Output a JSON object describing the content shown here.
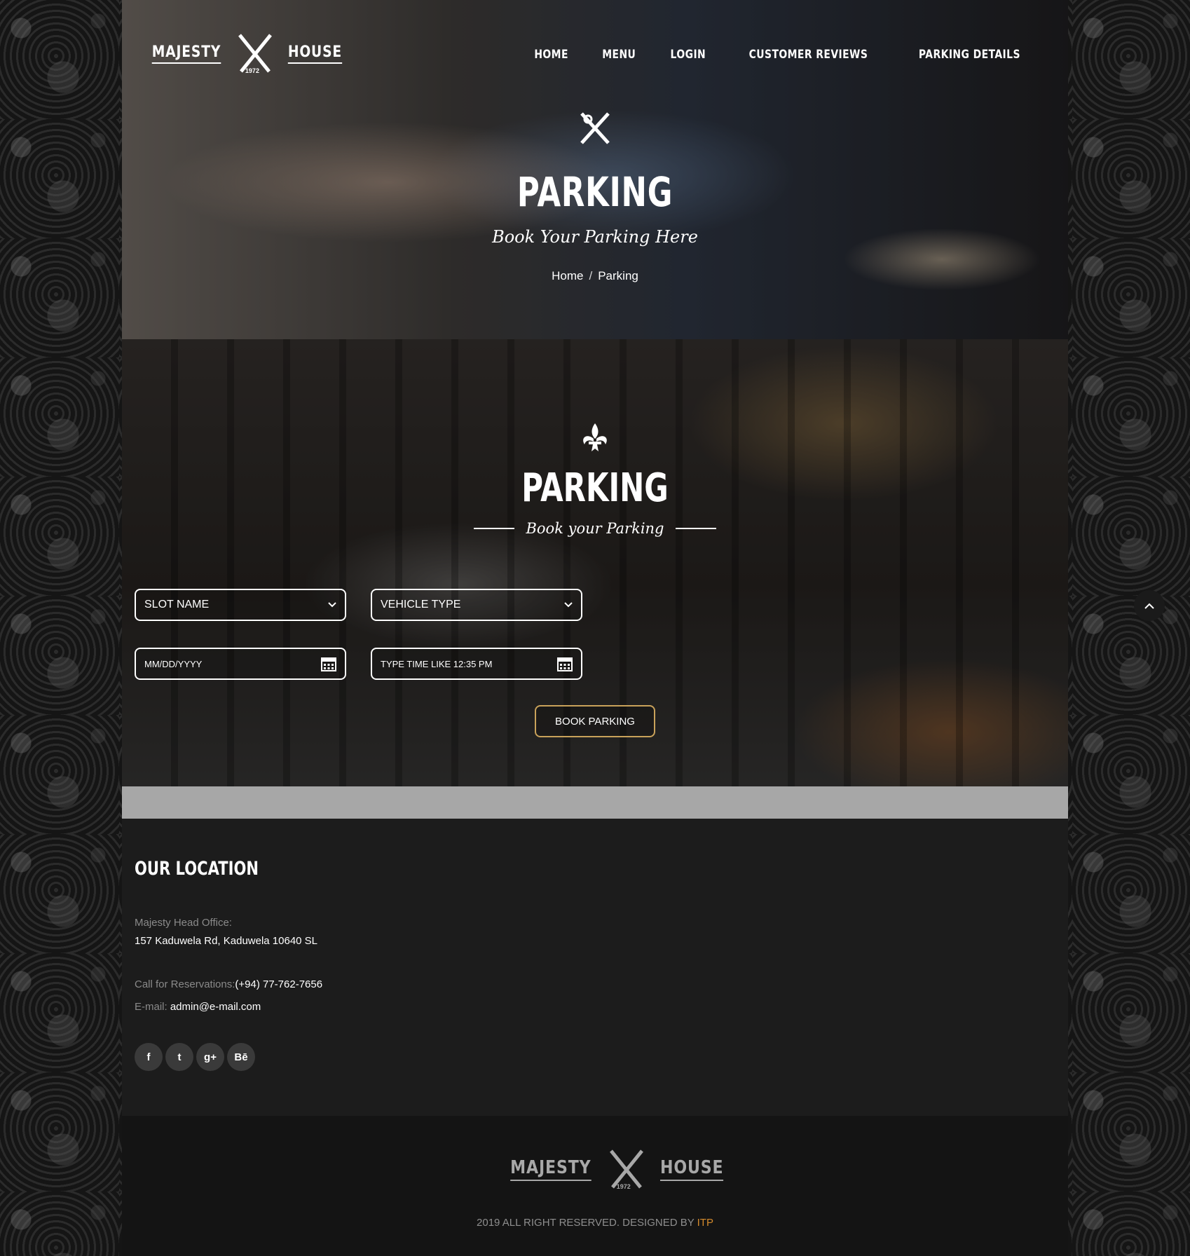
{
  "brand": {
    "left_word": "MAJESTY",
    "right_word": "HOUSE",
    "year": "1972"
  },
  "nav": {
    "items": [
      {
        "label": "HOME"
      },
      {
        "label": "MENU"
      },
      {
        "label": "LOGIN"
      },
      {
        "label": "CUSTOMER REVIEWS"
      },
      {
        "label": "PARKING DETAILS"
      }
    ]
  },
  "hero": {
    "title": "PARKING",
    "subtitle": "Book Your Parking Here",
    "breadcrumb": {
      "home": "Home",
      "separator": "/",
      "current": "Parking"
    }
  },
  "booking": {
    "title": "PARKING",
    "subtitle": "Book your Parking",
    "slot_select": {
      "value": "SLOT NAME"
    },
    "vehicle_select": {
      "value": "VEHICLE TYPE"
    },
    "date_input": {
      "placeholder": "MM/DD/YYYY"
    },
    "time_input": {
      "placeholder": "TYPE TIME LIKE 12:35 PM"
    },
    "submit_label": "BOOK PARKING"
  },
  "footer": {
    "location_title": "OUR LOCATION",
    "office_label": "Majesty Head Office:",
    "office_address": "157 Kaduwela Rd, Kaduwela 10640 SL",
    "reservation_label": "Call for Reservations:",
    "reservation_phone": "(+94) 77-762-7656",
    "email_label": "E-mail:",
    "email_value": "admin@e-mail.com",
    "socials": [
      {
        "icon": "facebook-icon",
        "glyph": "f"
      },
      {
        "icon": "twitter-icon",
        "glyph": "t"
      },
      {
        "icon": "google-plus-icon",
        "glyph": "g+"
      },
      {
        "icon": "behance-icon",
        "glyph": "Bē"
      }
    ],
    "copyright_text": "2019 ALL RIGHT RESERVED. DESIGNED BY",
    "copyright_brand": "ITP"
  },
  "colors": {
    "accent": "#c9a25a",
    "brand_link": "#d48a2c",
    "footer_bg": "#1c1c1c"
  }
}
